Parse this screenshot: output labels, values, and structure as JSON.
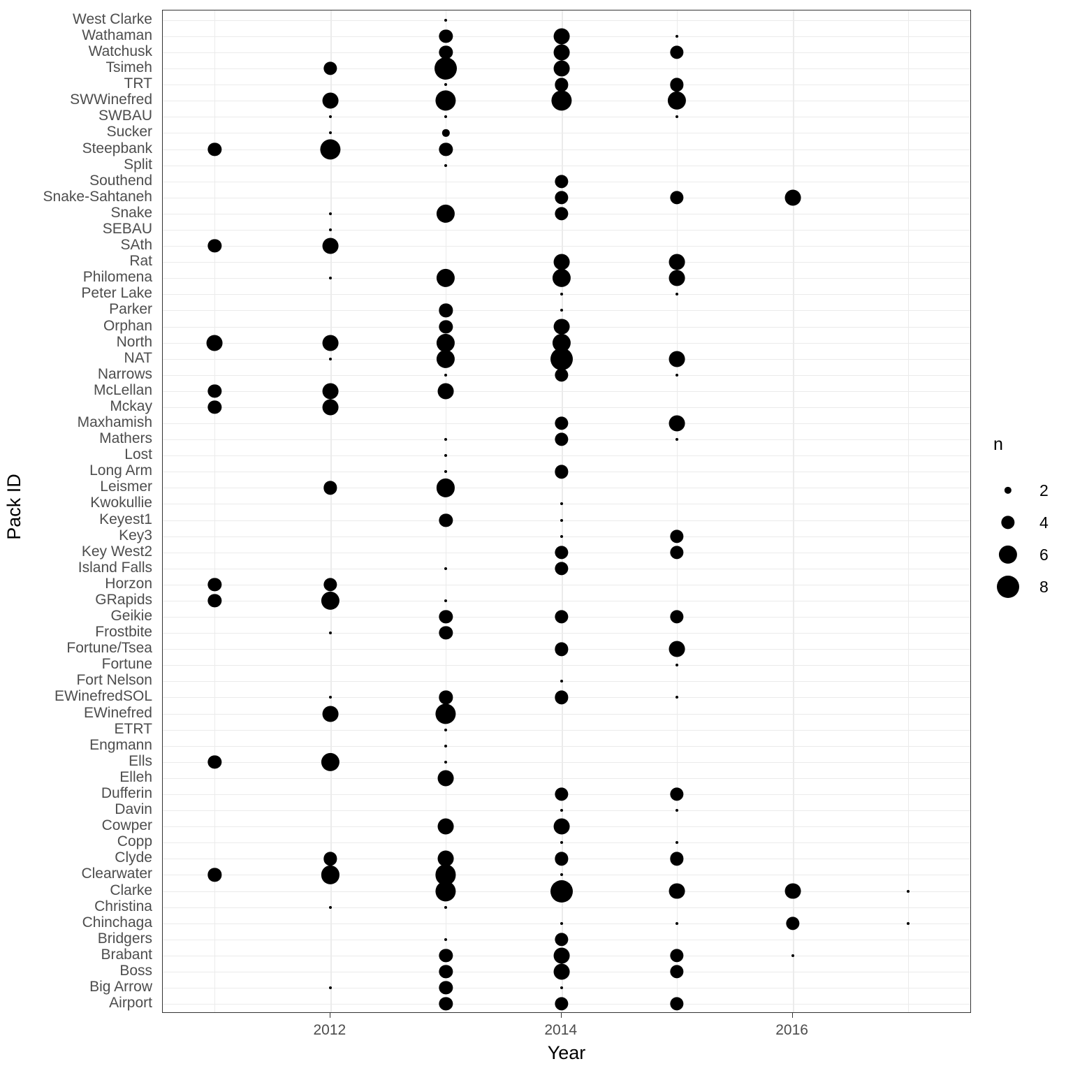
{
  "chart_data": {
    "type": "scatter",
    "subtype": "bubble",
    "title": "",
    "xlabel": "Year",
    "ylabel": "Pack ID",
    "grid": true,
    "legend": {
      "position": "right",
      "title": "n",
      "breaks": [
        2,
        4,
        6,
        8
      ],
      "labels": [
        "2",
        "4",
        "6",
        "8"
      ]
    },
    "size_range": [
      2,
      8
    ],
    "point_color": "#000000",
    "panel_background": "#ffffff",
    "gridline_color": "#ebebeb",
    "axis_text_color": "#4d4d4d",
    "x": {
      "ticks": [
        2012,
        2014,
        2016
      ],
      "tick_labels": [
        "2012",
        "2014",
        "2016"
      ],
      "xlim": [
        2010.55,
        2017.55
      ],
      "year_values": [
        2011,
        2012,
        2013,
        2014,
        2015,
        2016,
        2017
      ]
    },
    "y": {
      "categories": [
        "Airport",
        "Big Arrow",
        "Boss",
        "Brabant",
        "Bridgers",
        "Chinchaga",
        "Christina",
        "Clarke",
        "Clearwater",
        "Clyde",
        "Copp",
        "Cowper",
        "Davin",
        "Dufferin",
        "Elleh",
        "Ells",
        "Engmann",
        "ETRT",
        "EWinefred",
        "EWinefredSOL",
        "Fort Nelson",
        "Fortune",
        "Fortune/Tsea",
        "Frostbite",
        "Geikie",
        "GRapids",
        "Horzon",
        "Island Falls",
        "Key West2",
        "Key3",
        "Keyest1",
        "Kwokullie",
        "Leismer",
        "Long Arm",
        "Lost",
        "Mathers",
        "Maxhamish",
        "Mckay",
        "McLellan",
        "Narrows",
        "NAT",
        "North",
        "Orphan",
        "Parker",
        "Peter Lake",
        "Philomena",
        "Rat",
        "SAth",
        "SEBAU",
        "Snake",
        "Snake-Sahtaneh",
        "Southend",
        "Split",
        "Steepbank",
        "Sucker",
        "SWBAU",
        "SWWinefred",
        "TRT",
        "Tsimeh",
        "Watchusk",
        "Wathaman",
        "West Clarke"
      ]
    },
    "points": [
      {
        "pack": "West Clarke",
        "year": 2013,
        "n": 1
      },
      {
        "pack": "Wathaman",
        "year": 2013,
        "n": 4
      },
      {
        "pack": "Wathaman",
        "year": 2014,
        "n": 5
      },
      {
        "pack": "Wathaman",
        "year": 2015,
        "n": 1
      },
      {
        "pack": "Watchusk",
        "year": 2013,
        "n": 4
      },
      {
        "pack": "Watchusk",
        "year": 2014,
        "n": 5
      },
      {
        "pack": "Watchusk",
        "year": 2015,
        "n": 4
      },
      {
        "pack": "Tsimeh",
        "year": 2012,
        "n": 4
      },
      {
        "pack": "Tsimeh",
        "year": 2013,
        "n": 8
      },
      {
        "pack": "Tsimeh",
        "year": 2014,
        "n": 5
      },
      {
        "pack": "TRT",
        "year": 2013,
        "n": 1
      },
      {
        "pack": "TRT",
        "year": 2014,
        "n": 4
      },
      {
        "pack": "TRT",
        "year": 2015,
        "n": 4
      },
      {
        "pack": "SWWinefred",
        "year": 2012,
        "n": 5
      },
      {
        "pack": "SWWinefred",
        "year": 2013,
        "n": 7
      },
      {
        "pack": "SWWinefred",
        "year": 2014,
        "n": 7
      },
      {
        "pack": "SWWinefred",
        "year": 2015,
        "n": 6
      },
      {
        "pack": "SWBAU",
        "year": 2012,
        "n": 1
      },
      {
        "pack": "SWBAU",
        "year": 2013,
        "n": 1
      },
      {
        "pack": "SWBAU",
        "year": 2015,
        "n": 1
      },
      {
        "pack": "Sucker",
        "year": 2012,
        "n": 1
      },
      {
        "pack": "Sucker",
        "year": 2013,
        "n": 2
      },
      {
        "pack": "Steepbank",
        "year": 2011,
        "n": 4
      },
      {
        "pack": "Steepbank",
        "year": 2012,
        "n": 7
      },
      {
        "pack": "Steepbank",
        "year": 2013,
        "n": 4
      },
      {
        "pack": "Split",
        "year": 2013,
        "n": 1
      },
      {
        "pack": "Southend",
        "year": 2014,
        "n": 4
      },
      {
        "pack": "Snake-Sahtaneh",
        "year": 2014,
        "n": 4
      },
      {
        "pack": "Snake-Sahtaneh",
        "year": 2015,
        "n": 4
      },
      {
        "pack": "Snake-Sahtaneh",
        "year": 2016,
        "n": 5
      },
      {
        "pack": "Snake",
        "year": 2012,
        "n": 1
      },
      {
        "pack": "Snake",
        "year": 2013,
        "n": 6
      },
      {
        "pack": "Snake",
        "year": 2014,
        "n": 4
      },
      {
        "pack": "SEBAU",
        "year": 2012,
        "n": 1
      },
      {
        "pack": "SAth",
        "year": 2011,
        "n": 4
      },
      {
        "pack": "SAth",
        "year": 2012,
        "n": 5
      },
      {
        "pack": "Rat",
        "year": 2014,
        "n": 5
      },
      {
        "pack": "Rat",
        "year": 2015,
        "n": 5
      },
      {
        "pack": "Philomena",
        "year": 2012,
        "n": 1
      },
      {
        "pack": "Philomena",
        "year": 2013,
        "n": 6
      },
      {
        "pack": "Philomena",
        "year": 2014,
        "n": 6
      },
      {
        "pack": "Philomena",
        "year": 2015,
        "n": 5
      },
      {
        "pack": "Peter Lake",
        "year": 2014,
        "n": 1
      },
      {
        "pack": "Peter Lake",
        "year": 2015,
        "n": 1
      },
      {
        "pack": "Parker",
        "year": 2013,
        "n": 4
      },
      {
        "pack": "Parker",
        "year": 2014,
        "n": 1
      },
      {
        "pack": "Orphan",
        "year": 2013,
        "n": 4
      },
      {
        "pack": "Orphan",
        "year": 2014,
        "n": 5
      },
      {
        "pack": "North",
        "year": 2011,
        "n": 5
      },
      {
        "pack": "North",
        "year": 2012,
        "n": 5
      },
      {
        "pack": "North",
        "year": 2013,
        "n": 6
      },
      {
        "pack": "North",
        "year": 2014,
        "n": 6
      },
      {
        "pack": "NAT",
        "year": 2012,
        "n": 1
      },
      {
        "pack": "NAT",
        "year": 2013,
        "n": 6
      },
      {
        "pack": "NAT",
        "year": 2014,
        "n": 8
      },
      {
        "pack": "NAT",
        "year": 2015,
        "n": 5
      },
      {
        "pack": "Narrows",
        "year": 2013,
        "n": 1
      },
      {
        "pack": "Narrows",
        "year": 2014,
        "n": 4
      },
      {
        "pack": "Narrows",
        "year": 2015,
        "n": 1
      },
      {
        "pack": "McLellan",
        "year": 2011,
        "n": 4
      },
      {
        "pack": "McLellan",
        "year": 2012,
        "n": 5
      },
      {
        "pack": "McLellan",
        "year": 2013,
        "n": 5
      },
      {
        "pack": "Mckay",
        "year": 2011,
        "n": 4
      },
      {
        "pack": "Mckay",
        "year": 2012,
        "n": 5
      },
      {
        "pack": "Maxhamish",
        "year": 2014,
        "n": 4
      },
      {
        "pack": "Maxhamish",
        "year": 2015,
        "n": 5
      },
      {
        "pack": "Mathers",
        "year": 2013,
        "n": 1
      },
      {
        "pack": "Mathers",
        "year": 2014,
        "n": 4
      },
      {
        "pack": "Mathers",
        "year": 2015,
        "n": 1
      },
      {
        "pack": "Lost",
        "year": 2013,
        "n": 1
      },
      {
        "pack": "Long Arm",
        "year": 2013,
        "n": 1
      },
      {
        "pack": "Long Arm",
        "year": 2014,
        "n": 4
      },
      {
        "pack": "Leismer",
        "year": 2012,
        "n": 4
      },
      {
        "pack": "Leismer",
        "year": 2013,
        "n": 6
      },
      {
        "pack": "Kwokullie",
        "year": 2014,
        "n": 1
      },
      {
        "pack": "Keyest1",
        "year": 2013,
        "n": 4
      },
      {
        "pack": "Keyest1",
        "year": 2014,
        "n": 1
      },
      {
        "pack": "Key3",
        "year": 2014,
        "n": 1
      },
      {
        "pack": "Key3",
        "year": 2015,
        "n": 4
      },
      {
        "pack": "Key West2",
        "year": 2014,
        "n": 4
      },
      {
        "pack": "Key West2",
        "year": 2015,
        "n": 4
      },
      {
        "pack": "Island Falls",
        "year": 2013,
        "n": 1
      },
      {
        "pack": "Island Falls",
        "year": 2014,
        "n": 4
      },
      {
        "pack": "Horzon",
        "year": 2011,
        "n": 4
      },
      {
        "pack": "Horzon",
        "year": 2012,
        "n": 4
      },
      {
        "pack": "GRapids",
        "year": 2011,
        "n": 4
      },
      {
        "pack": "GRapids",
        "year": 2012,
        "n": 6
      },
      {
        "pack": "GRapids",
        "year": 2013,
        "n": 1
      },
      {
        "pack": "Geikie",
        "year": 2013,
        "n": 4
      },
      {
        "pack": "Geikie",
        "year": 2014,
        "n": 4
      },
      {
        "pack": "Geikie",
        "year": 2015,
        "n": 4
      },
      {
        "pack": "Frostbite",
        "year": 2012,
        "n": 1
      },
      {
        "pack": "Frostbite",
        "year": 2013,
        "n": 4
      },
      {
        "pack": "Fortune/Tsea",
        "year": 2014,
        "n": 4
      },
      {
        "pack": "Fortune/Tsea",
        "year": 2015,
        "n": 5
      },
      {
        "pack": "Fortune",
        "year": 2015,
        "n": 1
      },
      {
        "pack": "Fort Nelson",
        "year": 2014,
        "n": 1
      },
      {
        "pack": "EWinefredSOL",
        "year": 2012,
        "n": 1
      },
      {
        "pack": "EWinefredSOL",
        "year": 2013,
        "n": 4
      },
      {
        "pack": "EWinefredSOL",
        "year": 2014,
        "n": 4
      },
      {
        "pack": "EWinefredSOL",
        "year": 2015,
        "n": 1
      },
      {
        "pack": "EWinefred",
        "year": 2012,
        "n": 5
      },
      {
        "pack": "EWinefred",
        "year": 2013,
        "n": 7
      },
      {
        "pack": "ETRT",
        "year": 2013,
        "n": 1
      },
      {
        "pack": "Engmann",
        "year": 2013,
        "n": 1
      },
      {
        "pack": "Ells",
        "year": 2011,
        "n": 4
      },
      {
        "pack": "Ells",
        "year": 2012,
        "n": 6
      },
      {
        "pack": "Ells",
        "year": 2013,
        "n": 1
      },
      {
        "pack": "Elleh",
        "year": 2013,
        "n": 5
      },
      {
        "pack": "Dufferin",
        "year": 2014,
        "n": 4
      },
      {
        "pack": "Dufferin",
        "year": 2015,
        "n": 4
      },
      {
        "pack": "Davin",
        "year": 2014,
        "n": 1
      },
      {
        "pack": "Davin",
        "year": 2015,
        "n": 1
      },
      {
        "pack": "Cowper",
        "year": 2013,
        "n": 5
      },
      {
        "pack": "Cowper",
        "year": 2014,
        "n": 5
      },
      {
        "pack": "Copp",
        "year": 2014,
        "n": 1
      },
      {
        "pack": "Copp",
        "year": 2015,
        "n": 1
      },
      {
        "pack": "Clyde",
        "year": 2012,
        "n": 4
      },
      {
        "pack": "Clyde",
        "year": 2013,
        "n": 5
      },
      {
        "pack": "Clyde",
        "year": 2014,
        "n": 4
      },
      {
        "pack": "Clyde",
        "year": 2015,
        "n": 4
      },
      {
        "pack": "Clearwater",
        "year": 2011,
        "n": 4
      },
      {
        "pack": "Clearwater",
        "year": 2012,
        "n": 6
      },
      {
        "pack": "Clearwater",
        "year": 2013,
        "n": 7
      },
      {
        "pack": "Clearwater",
        "year": 2014,
        "n": 1
      },
      {
        "pack": "Clarke",
        "year": 2013,
        "n": 7
      },
      {
        "pack": "Clarke",
        "year": 2014,
        "n": 8
      },
      {
        "pack": "Clarke",
        "year": 2015,
        "n": 5
      },
      {
        "pack": "Clarke",
        "year": 2016,
        "n": 5
      },
      {
        "pack": "Clarke",
        "year": 2017,
        "n": 1
      },
      {
        "pack": "Christina",
        "year": 2012,
        "n": 1
      },
      {
        "pack": "Christina",
        "year": 2013,
        "n": 1
      },
      {
        "pack": "Chinchaga",
        "year": 2014,
        "n": 1
      },
      {
        "pack": "Chinchaga",
        "year": 2015,
        "n": 1
      },
      {
        "pack": "Chinchaga",
        "year": 2016,
        "n": 4
      },
      {
        "pack": "Chinchaga",
        "year": 2017,
        "n": 1
      },
      {
        "pack": "Bridgers",
        "year": 2013,
        "n": 1
      },
      {
        "pack": "Bridgers",
        "year": 2014,
        "n": 4
      },
      {
        "pack": "Brabant",
        "year": 2013,
        "n": 4
      },
      {
        "pack": "Brabant",
        "year": 2014,
        "n": 5
      },
      {
        "pack": "Brabant",
        "year": 2015,
        "n": 4
      },
      {
        "pack": "Brabant",
        "year": 2016,
        "n": 1
      },
      {
        "pack": "Boss",
        "year": 2013,
        "n": 4
      },
      {
        "pack": "Boss",
        "year": 2014,
        "n": 5
      },
      {
        "pack": "Boss",
        "year": 2015,
        "n": 4
      },
      {
        "pack": "Big Arrow",
        "year": 2012,
        "n": 1
      },
      {
        "pack": "Big Arrow",
        "year": 2013,
        "n": 4
      },
      {
        "pack": "Big Arrow",
        "year": 2014,
        "n": 1
      },
      {
        "pack": "Airport",
        "year": 2013,
        "n": 4
      },
      {
        "pack": "Airport",
        "year": 2014,
        "n": 4
      },
      {
        "pack": "Airport",
        "year": 2015,
        "n": 4
      }
    ]
  }
}
